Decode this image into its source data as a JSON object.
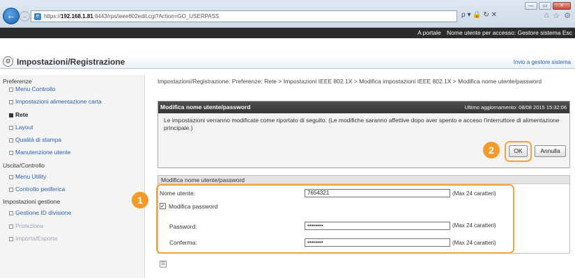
{
  "browser": {
    "url_prefix": "https://",
    "url_host": "192.168.1.81",
    "url_rest": ":8443/rps/ieee802edit.cgi?Action=GO_USERPASS",
    "tools": "ρ ▾ 🔒 ↻ ✕",
    "win_min": "—",
    "win_max": "▭",
    "win_close": "✕"
  },
  "header": {
    "portal_link": "A portale",
    "user_info": "Nome utente per accesso: Gestore sistema Esc"
  },
  "title": {
    "text": "Impostazioni/Registrazione",
    "top_link": "Invio a gestore sistema"
  },
  "sidebar": {
    "sections": [
      {
        "heading": "Preferenze",
        "items": [
          {
            "label": "Menu Controllo"
          },
          {
            "label": "Impostazioni alimentazione carta"
          },
          {
            "label": "Rete"
          },
          {
            "label": "Layout"
          },
          {
            "label": "Qualità di stampa"
          },
          {
            "label": "Manutenzione utente"
          }
        ]
      },
      {
        "heading": "Uscita/Controllo",
        "items": [
          {
            "label": "Menu Utility"
          },
          {
            "label": "Controllo periferica"
          }
        ]
      },
      {
        "heading": "Impostazioni gestione",
        "items": [
          {
            "label": "Gestione ID divisione"
          },
          {
            "label": "Protezione"
          },
          {
            "label": "Importa/Esporta"
          }
        ]
      }
    ]
  },
  "breadcrumb": "Impostazioni/Registrazione: Preferenze: Rete > Impostazioni IEEE 802.1X > Modifica impostazioni IEEE 802.1X > Modifica nome utente/password",
  "panel1": {
    "title": "Modifica nome utente/password",
    "updated": "Ultimo aggiornamento: 08/08 2015 15:32:06",
    "message": "Le impostazioni verranno modificate come riportato di seguito. (Le modifiche saranno affettive dopo aver spento e acceso l'interruttore di alimentazione principale.)",
    "ok_label": "OK",
    "cancel_label": "Annulla"
  },
  "form": {
    "title": "Modifica nome utente/password",
    "username_label": "Nome utente:",
    "username_value": "7654321",
    "username_hint": "(Max 24 caratteri)",
    "change_password_label": "Modifica password",
    "change_password_checked": "✓",
    "password_label": "Password:",
    "password_value": "••••••••",
    "password_hint": "(Max 24 caratteri)",
    "confirm_label": "Conferma:",
    "confirm_value": "••••••••",
    "confirm_hint": "(Max 24 caratteri)"
  },
  "callouts": {
    "one": "1",
    "two": "2"
  },
  "colors": {
    "callout": "#f39a2a",
    "panel_header": "#3c3c3c",
    "link": "#2b5ea8"
  }
}
